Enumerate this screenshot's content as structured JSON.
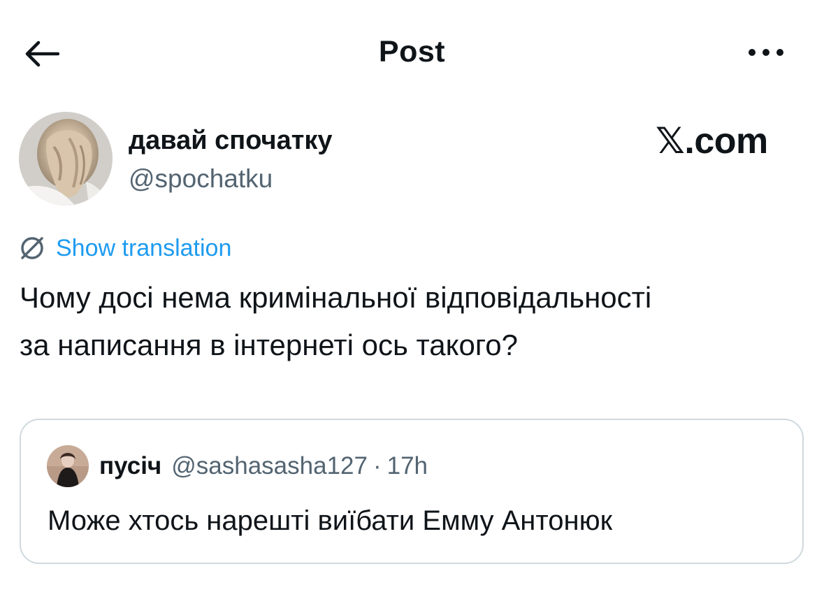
{
  "header": {
    "title": "Post",
    "back_icon": "arrow-left-icon",
    "more_icon": "more-horizontal-icon"
  },
  "author": {
    "display_name": "давай спочатку",
    "handle": "@spochatku"
  },
  "watermark": {
    "text": "𝕏.com"
  },
  "translation": {
    "label": "Show translation",
    "icon": "translate-globe-icon"
  },
  "tweet": {
    "lines": [
      "Чому досі нема кримінальної відповідальності",
      "за написання в інтернеті ось такого?"
    ]
  },
  "quote": {
    "display_name": "пусіч",
    "handle": "@sashasasha127",
    "separator": "·",
    "time": "17h",
    "text": "Може хтось нарешті виїбати Емму Антонюк"
  },
  "colors": {
    "text_primary": "#0f1419",
    "text_secondary": "#536471",
    "link": "#1d9bf0",
    "border": "#cfd9de"
  }
}
